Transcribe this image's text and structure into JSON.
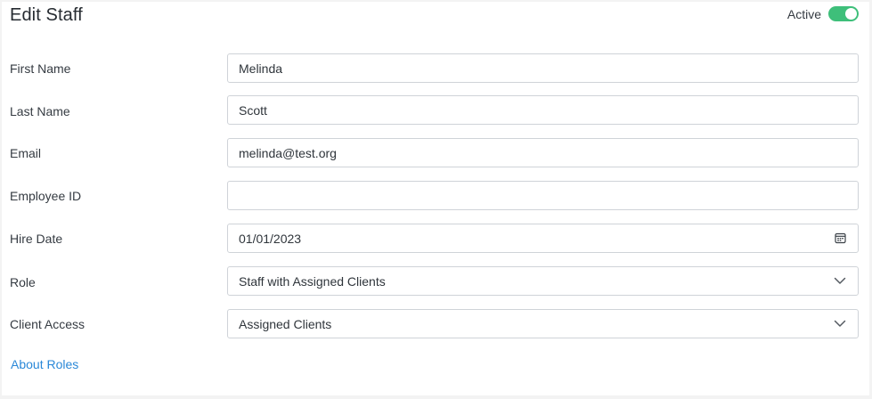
{
  "header": {
    "title": "Edit Staff",
    "active_label": "Active",
    "active_on": true
  },
  "form": {
    "first_name": {
      "label": "First Name",
      "value": "Melinda"
    },
    "last_name": {
      "label": "Last Name",
      "value": "Scott"
    },
    "email": {
      "label": "Email",
      "value": "melinda@test.org"
    },
    "employee_id": {
      "label": "Employee ID",
      "value": ""
    },
    "hire_date": {
      "label": "Hire Date",
      "value": "01/01/2023",
      "icon": "calendar-icon"
    },
    "role": {
      "label": "Role",
      "value": "Staff with Assigned Clients",
      "icon": "chevron-down-icon"
    },
    "client_access": {
      "label": "Client Access",
      "value": "Assigned Clients",
      "icon": "chevron-down-icon"
    }
  },
  "links": {
    "about_roles": "About Roles"
  },
  "colors": {
    "toggle_on": "#3ebf7a",
    "link": "#2a88d8",
    "border": "#cfd3d8"
  }
}
